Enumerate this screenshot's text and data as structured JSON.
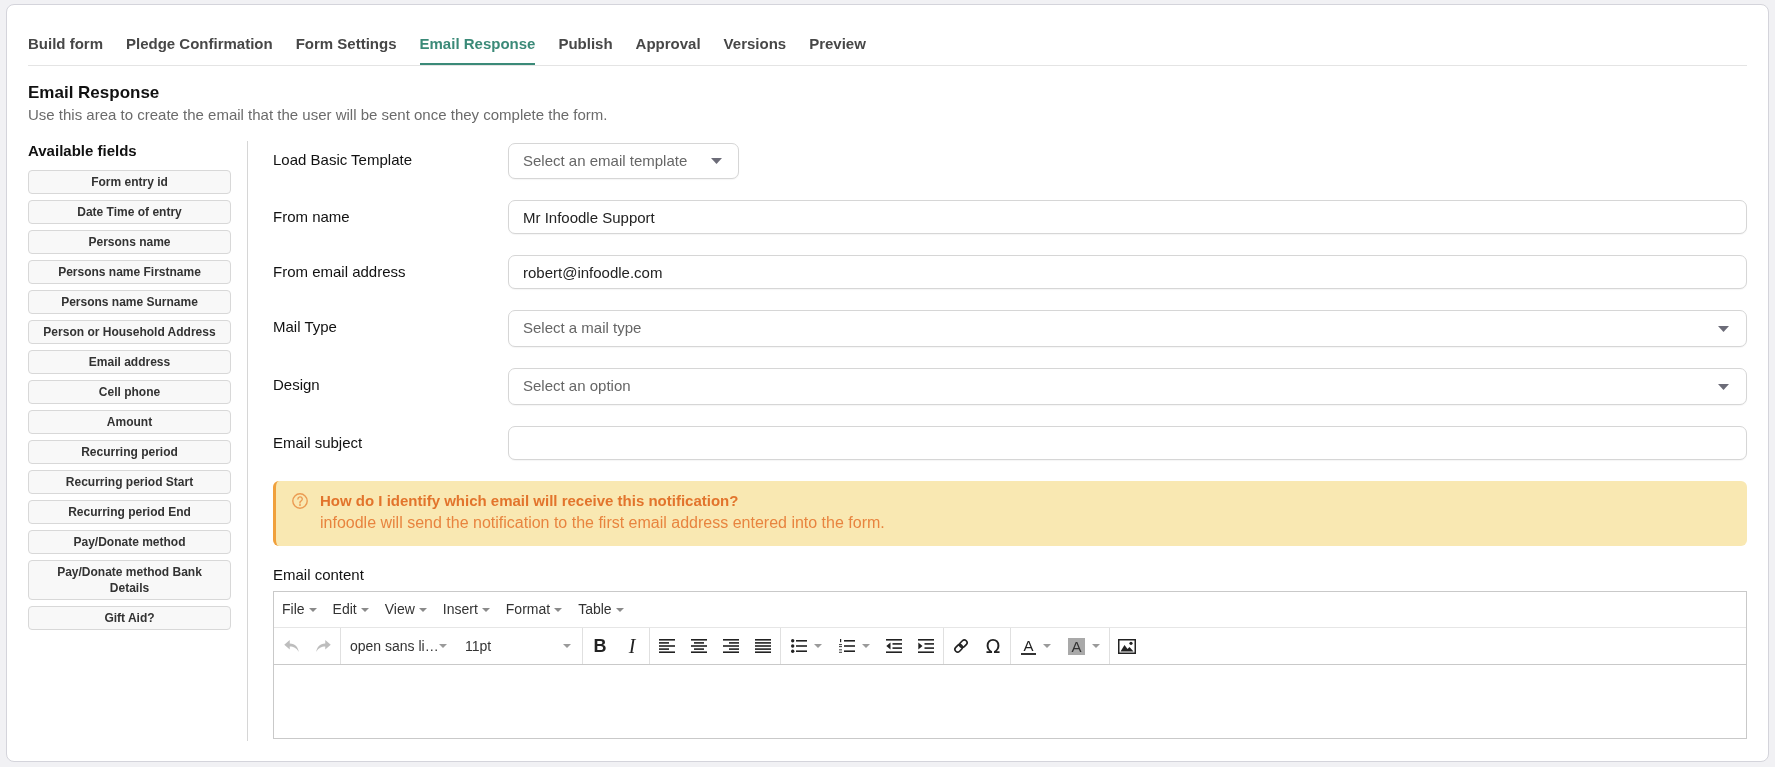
{
  "tabs": [
    {
      "label": "Build form",
      "selected": false
    },
    {
      "label": "Pledge Confirmation",
      "selected": false
    },
    {
      "label": "Form Settings",
      "selected": false
    },
    {
      "label": "Email Response",
      "selected": true
    },
    {
      "label": "Publish",
      "selected": false
    },
    {
      "label": "Approval",
      "selected": false
    },
    {
      "label": "Versions",
      "selected": false
    },
    {
      "label": "Preview",
      "selected": false
    }
  ],
  "section": {
    "title": "Email Response",
    "description": "Use this area to create the email that the user will be sent once they complete the form."
  },
  "available_fields": {
    "title": "Available fields",
    "items": [
      "Form entry id",
      "Date Time of entry",
      "Persons name",
      "Persons name Firstname",
      "Persons name Surname",
      "Person or Household Address",
      "Email address",
      "Cell phone",
      "Amount",
      "Recurring period",
      "Recurring period Start",
      "Recurring period End",
      "Pay/Donate method",
      "Pay/Donate method Bank Details",
      "Gift Aid?"
    ]
  },
  "form_fields": [
    {
      "kind": "dropdown",
      "label": "Load Basic Template",
      "placeholder": "Select an email template"
    },
    {
      "kind": "text",
      "label": "From name",
      "value": "Mr Infoodle Support"
    },
    {
      "kind": "text",
      "label": "From email address",
      "value": "robert@infoodle.com"
    },
    {
      "kind": "select",
      "label": "Mail Type",
      "placeholder": "Select a mail type"
    },
    {
      "kind": "select",
      "label": "Design",
      "placeholder": "Select an option"
    },
    {
      "kind": "text",
      "label": "Email subject"
    }
  ],
  "notice": {
    "title": "How do I identify which email will receive this notification?",
    "text": "infoodle will send the notification to the first email address entered into the form."
  },
  "editor": {
    "label": "Email content",
    "menubar": [
      "File",
      "Edit",
      "View",
      "Insert",
      "Format",
      "Table"
    ],
    "toolbar": {
      "undo": {
        "disabled": true
      },
      "redo": {
        "disabled": true
      },
      "font_family": "open sans li…",
      "font_size": "11pt",
      "bold": "B",
      "italic": "I",
      "special_character": "Ω",
      "text_color": "A",
      "highlight_color": "A"
    }
  }
}
